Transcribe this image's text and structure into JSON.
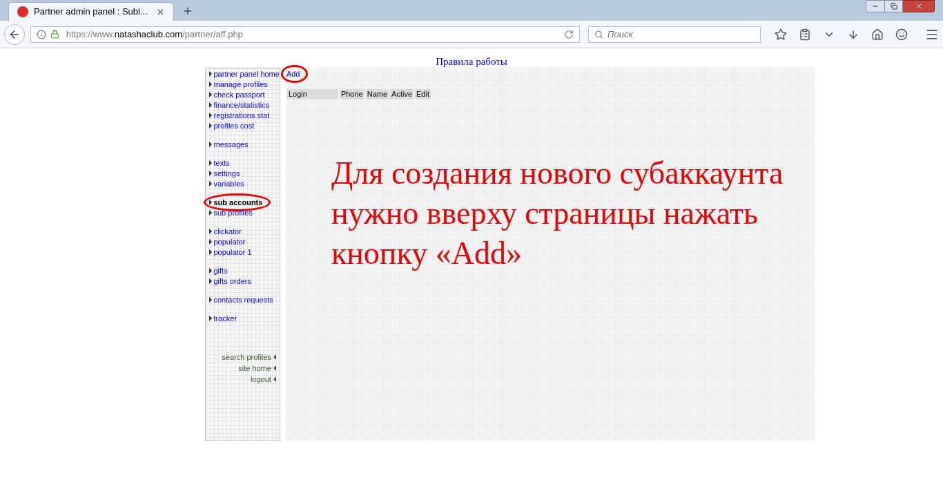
{
  "browser": {
    "tab": {
      "title": "Partner admin panel : Subl..."
    },
    "url": {
      "scheme": "https://www.",
      "domain": "natashaclub.com",
      "path": "/partner/aff.php"
    },
    "search": {
      "placeholder": "Поиск"
    }
  },
  "page": {
    "title": "Правила работы",
    "menu": {
      "groups": [
        [
          {
            "label": "partner panel home",
            "selected": false,
            "circled": false
          },
          {
            "label": "manage profiles",
            "selected": false,
            "circled": false
          },
          {
            "label": "check passport",
            "selected": false,
            "circled": false
          },
          {
            "label": "finance/statistics",
            "selected": false,
            "circled": false
          },
          {
            "label": "registrations stat",
            "selected": false,
            "circled": false
          },
          {
            "label": "profiles cost",
            "selected": false,
            "circled": false
          }
        ],
        [
          {
            "label": "messages",
            "selected": false,
            "circled": false
          }
        ],
        [
          {
            "label": "texts",
            "selected": false,
            "circled": false
          },
          {
            "label": "settings",
            "selected": false,
            "circled": false
          },
          {
            "label": "variables",
            "selected": false,
            "circled": false
          }
        ],
        [
          {
            "label": "sub accounts",
            "selected": true,
            "circled": true
          },
          {
            "label": "sub profiles",
            "selected": false,
            "circled": false
          }
        ],
        [
          {
            "label": "clickator",
            "selected": false,
            "circled": false
          },
          {
            "label": "populator",
            "selected": false,
            "circled": false
          },
          {
            "label": "populator 1",
            "selected": false,
            "circled": false
          }
        ],
        [
          {
            "label": "gifts",
            "selected": false,
            "circled": false
          },
          {
            "label": "gifts orders",
            "selected": false,
            "circled": false
          }
        ],
        [
          {
            "label": "contacts requests",
            "selected": false,
            "circled": false
          }
        ],
        [
          {
            "label": "tracker",
            "selected": false,
            "circled": false
          }
        ]
      ],
      "footer_links": [
        "search profiles",
        "site home",
        "logout"
      ]
    },
    "add_link": {
      "label": "Add",
      "circled": true
    },
    "table": {
      "columns": [
        "Login",
        "Phone",
        "Name",
        "Active",
        "Edit"
      ]
    },
    "annotation": "Для создания нового субаккаунта нужно вверху страницы нажать кнопку «Add»"
  }
}
